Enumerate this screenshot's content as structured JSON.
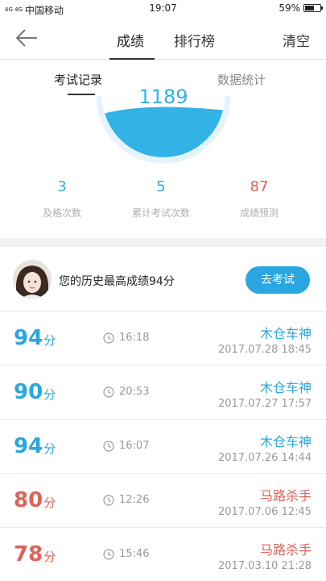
{
  "status_bar": {
    "signal": "4G 4G",
    "carrier": "中国移动",
    "time": "19:07",
    "battery": "59%",
    "battery_level": 0.59
  },
  "nav": {
    "tab_score": "成绩",
    "tab_ranking": "排行榜",
    "clear": "清空"
  },
  "subtabs": {
    "records": "考试记录",
    "stats": "数据统计"
  },
  "gauge": {
    "total_score": "1189",
    "fill_level": 0.55,
    "color": "#33b2e6"
  },
  "stats": [
    {
      "value": "3",
      "label": "及格次数"
    },
    {
      "value": "5",
      "label": "累计考试次数"
    },
    {
      "value": "87",
      "label": "成绩预测"
    }
  ],
  "best": {
    "text": "您的历史最高成绩94分",
    "button": "去考试"
  },
  "unit": "分",
  "records": [
    {
      "score": "94",
      "duration": "16:18",
      "title": "木仓车神",
      "date": "2017.07.28  18:45",
      "color": "#2aa6e0"
    },
    {
      "score": "90",
      "duration": "20:53",
      "title": "木仓车神",
      "date": "2017.07.27  17:57",
      "color": "#2aa6e0"
    },
    {
      "score": "94",
      "duration": "16:07",
      "title": "木仓车神",
      "date": "2017.07.26  14:44",
      "color": "#2aa6e0"
    },
    {
      "score": "80",
      "duration": "12:26",
      "title": "马路杀手",
      "date": "2017.07.06  12:45",
      "color": "#e0625d"
    },
    {
      "score": "78",
      "duration": "15:46",
      "title": "马路杀手",
      "date": "2017.03.10  21:28",
      "color": "#e0625d"
    }
  ]
}
